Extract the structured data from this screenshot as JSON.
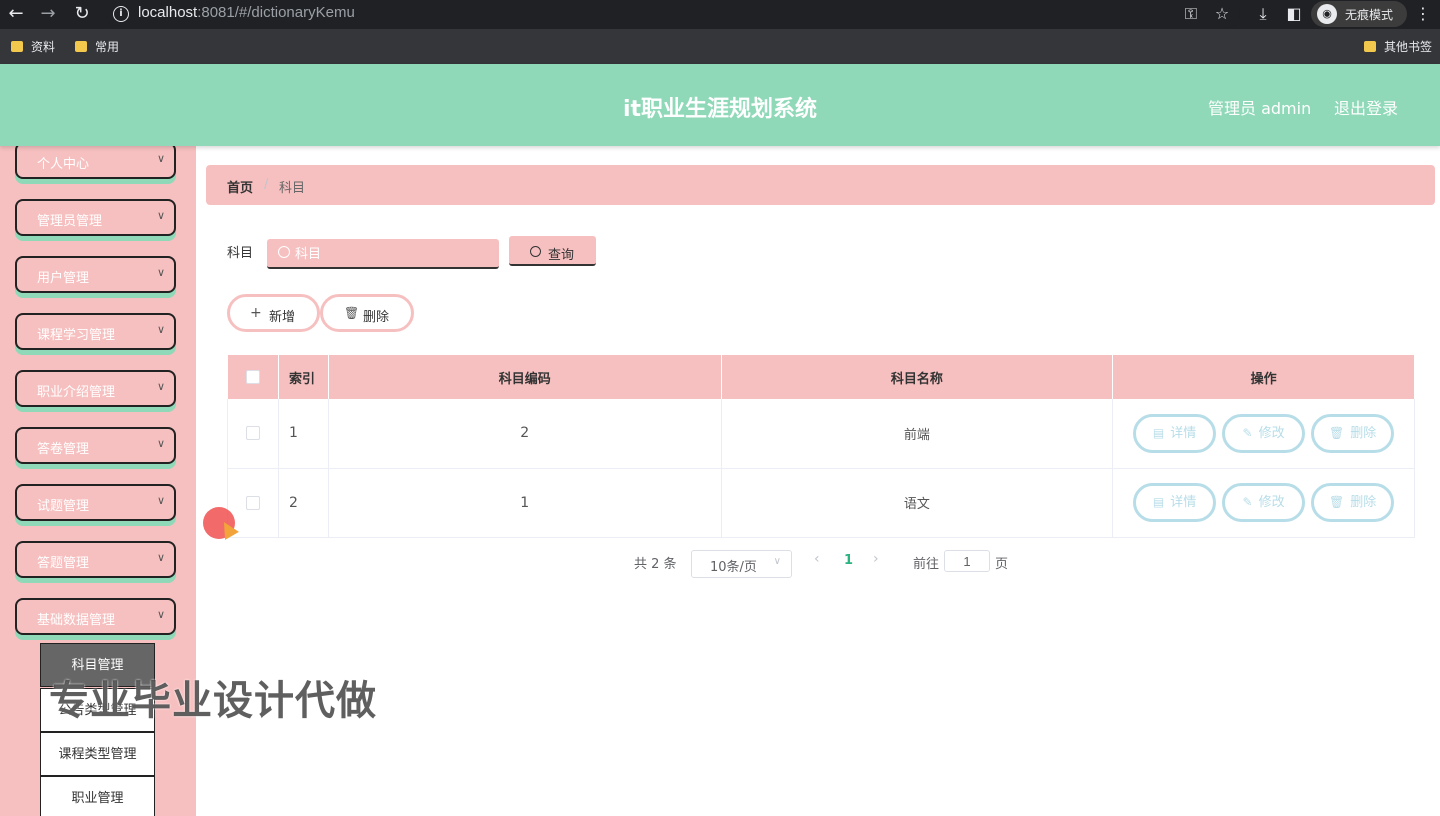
{
  "browser": {
    "url_host": "localhost",
    "url_path": ":8081/#/dictionaryKemu",
    "incognito_label": "无痕模式",
    "bookmarks": [
      "资料",
      "常用"
    ],
    "other_bookmarks": "其他书签"
  },
  "header": {
    "title": "it职业生涯规划系统",
    "admin_label": "管理员 admin",
    "logout_label": "退出登录"
  },
  "sidebar": {
    "items": [
      {
        "label": "个人中心"
      },
      {
        "label": "管理员管理"
      },
      {
        "label": "用户管理"
      },
      {
        "label": "课程学习管理"
      },
      {
        "label": "职业介绍管理"
      },
      {
        "label": "答卷管理"
      },
      {
        "label": "试题管理"
      },
      {
        "label": "答题管理"
      },
      {
        "label": "基础数据管理"
      }
    ],
    "submenu": [
      {
        "label": "科目管理"
      },
      {
        "label": "公告类型管理"
      },
      {
        "label": "课程类型管理"
      },
      {
        "label": "职业管理"
      }
    ]
  },
  "breadcrumb": {
    "home": "首页",
    "separator": "/",
    "current": "科目"
  },
  "search": {
    "label": "科目",
    "placeholder": "科目",
    "button_label": "查询"
  },
  "actions": {
    "add_label": "新增",
    "delete_label": "删除"
  },
  "table": {
    "headers": [
      "索引",
      "科目编码",
      "科目名称",
      "操作"
    ],
    "rows": [
      {
        "index": "1",
        "code": "2",
        "name": "前端"
      },
      {
        "index": "2",
        "code": "1",
        "name": "语文"
      }
    ],
    "row_actions": {
      "detail": "详情",
      "edit": "修改",
      "delete": "删除"
    }
  },
  "pagination": {
    "total": "共 2 条",
    "page_size": "10条/页",
    "current_page": "1",
    "goto_label": "前往",
    "goto_value": "1",
    "goto_suffix": "页"
  },
  "watermark": "专业毕业设计代做",
  "colors": {
    "header_bg": "#8fd8b8",
    "sidebar_bg": "#f7c0c0",
    "accent_pink": "#f7c0c0",
    "op_button_border": "#b7dde8",
    "pagination_active": "#2bb380"
  }
}
